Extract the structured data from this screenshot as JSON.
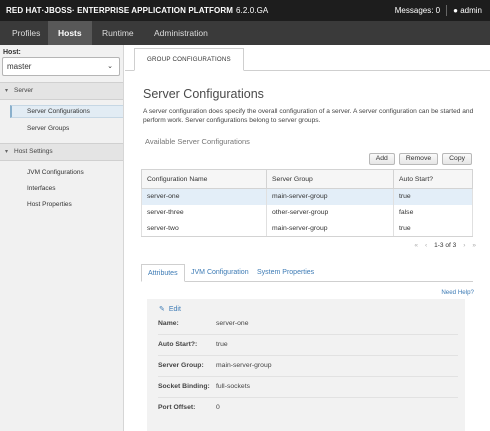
{
  "header": {
    "brand": "RED HAT·JBOSS· ENTERPRISE APPLICATION PLATFORM",
    "version": "6.2.0.GA",
    "messages": "Messages: 0",
    "user": "admin"
  },
  "nav": {
    "tabs": [
      {
        "label": "Profiles"
      },
      {
        "label": "Hosts"
      },
      {
        "label": "Runtime"
      },
      {
        "label": "Administration"
      }
    ],
    "active": "Hosts"
  },
  "sidebar": {
    "host_label": "Host:",
    "host_value": "master",
    "sections": [
      {
        "title": "Server",
        "items": [
          "Server Configurations",
          "Server Groups"
        ]
      },
      {
        "title": "Host Settings",
        "items": [
          "JVM Configurations",
          "Interfaces",
          "Host Properties"
        ]
      }
    ],
    "active_item": "Server Configurations"
  },
  "main": {
    "subtab": "GROUP CONFIGURATIONS",
    "title": "Server Configurations",
    "description": "A server configuration does specify the overall configuration of a server. A server configuration can be started and perform work. Server configurations belong to server groups.",
    "available_label": "Available Server Configurations",
    "buttons": {
      "add": "Add",
      "remove": "Remove",
      "copy": "Copy"
    },
    "table": {
      "columns": [
        "Configuration Name",
        "Server Group",
        "Auto Start?"
      ],
      "rows": [
        [
          "server-one",
          "main-server-group",
          "true"
        ],
        [
          "server-three",
          "other-server-group",
          "false"
        ],
        [
          "server-two",
          "main-server-group",
          "true"
        ]
      ],
      "selected_row": 0
    },
    "pager": "1-3 of 3",
    "detail_tabs": [
      "Attributes",
      "JVM Configuration",
      "System Properties"
    ],
    "need_help": "Need Help?",
    "edit_label": "Edit",
    "fields": [
      {
        "label": "Name:",
        "value": "server-one"
      },
      {
        "label": "Auto Start?:",
        "value": "true"
      },
      {
        "label": "Server Group:",
        "value": "main-server-group"
      },
      {
        "label": "Socket Binding:",
        "value": "full-sockets"
      },
      {
        "label": "Port Offset:",
        "value": "0"
      }
    ]
  },
  "colors": {
    "topbar": "#1d1d1d",
    "navbar": "#3a3a3a",
    "link": "#3d7bb5",
    "selected_row": "#e3eef8"
  }
}
